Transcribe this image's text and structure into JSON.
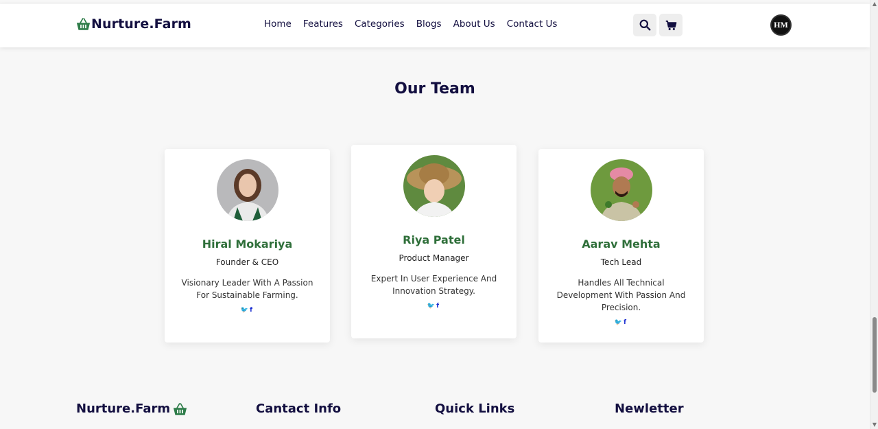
{
  "brand": {
    "name": "Nurture.Farm",
    "icon": "shopping-basket-icon",
    "color": "#2f7d4a"
  },
  "nav": {
    "items": [
      "Home",
      "Features",
      "Categories",
      "Blogs",
      "About Us",
      "Contact Us"
    ]
  },
  "header_icons": {
    "search": "search-icon",
    "cart": "cart-icon",
    "avatar_text": "HM"
  },
  "section": {
    "title": "Our Team"
  },
  "team": [
    {
      "name": "Hiral Mokariya",
      "role": "Founder & CEO",
      "desc": "Visionary Leader With A Passion For Sustainable Farming.",
      "social": "🐦 f"
    },
    {
      "name": "Riya Patel",
      "role": "Product Manager",
      "desc": "Expert In User Experience And Innovation Strategy.",
      "social": "🐦 f"
    },
    {
      "name": "Aarav Mehta",
      "role": "Tech Lead",
      "desc": "Handles All Technical Development With Passion And Precision.",
      "social": "🐦 f"
    }
  ],
  "footer": {
    "brand": "Nurture.Farm",
    "contact": "Cantact Info",
    "links": "Quick Links",
    "newsletter": "Newletter"
  },
  "colors": {
    "accent": "#2f6f3a",
    "text": "#130f40",
    "social": "#1c2fd1"
  }
}
